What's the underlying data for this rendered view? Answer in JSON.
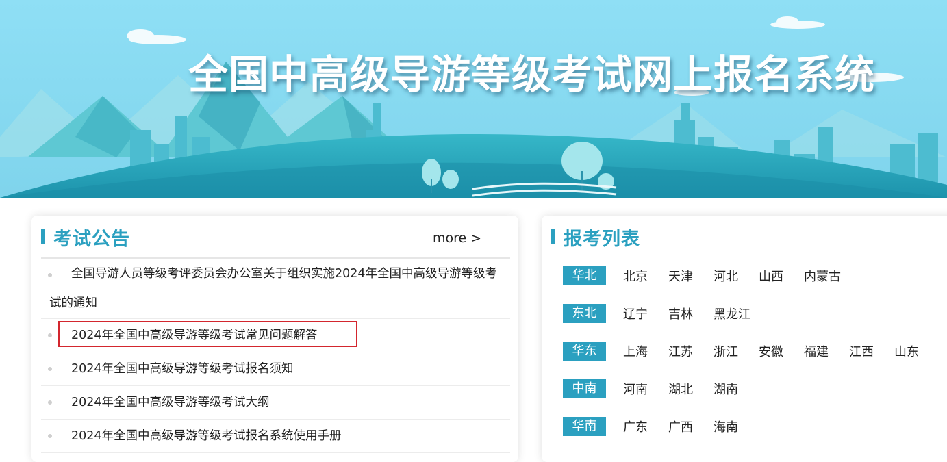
{
  "header": {
    "site_title": "全国中高级导游等级考试网上报名系统"
  },
  "notices": {
    "title": "考试公告",
    "more_label": "more >",
    "items": [
      "全国导游人员等级考评委员会办公室关于组织实施2024年全国中高级导游等级考试的通知",
      "2024年全国中高级导游等级考试常见问题解答",
      "2024年全国中高级导游等级考试报名须知",
      "2024年全国中高级导游等级考试大纲",
      "2024年全国中高级导游等级考试报名系统使用手册"
    ]
  },
  "registration": {
    "title": "报考列表",
    "regions": [
      {
        "name": "华北",
        "provinces": [
          "北京",
          "天津",
          "河北",
          "山西",
          "内蒙古"
        ]
      },
      {
        "name": "东北",
        "provinces": [
          "辽宁",
          "吉林",
          "黑龙江"
        ]
      },
      {
        "name": "华东",
        "provinces": [
          "上海",
          "江苏",
          "浙江",
          "安徽",
          "福建",
          "江西",
          "山东"
        ]
      },
      {
        "name": "中南",
        "provinces": [
          "河南",
          "湖北",
          "湖南"
        ]
      },
      {
        "name": "华南",
        "provinces": [
          "广东",
          "广西",
          "海南"
        ]
      }
    ]
  },
  "colors": {
    "accent": "#2ba0c0",
    "highlight_border": "#d3262e"
  }
}
